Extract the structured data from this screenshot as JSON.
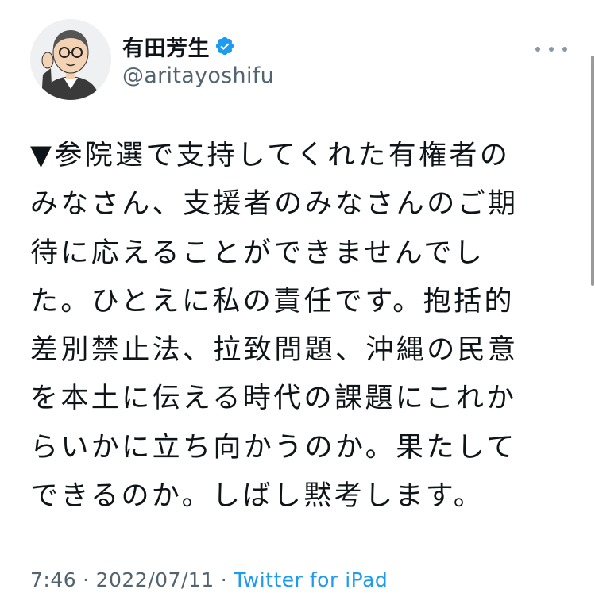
{
  "author": {
    "display_name": "有田芳生",
    "handle": "@aritayoshifu",
    "verified_icon": "verified-badge-icon",
    "avatar_icon": "caricature-avatar"
  },
  "tweet": {
    "lines": [
      "▼参院選で支持してくれた有権者の",
      "みなさん、支援者のみなさんのご期",
      "待に応えることができませんでし",
      "た。ひとえに私の責任です。抱括的",
      "差別禁止法、拉致問題、沖縄の民意",
      "を本土に伝える時代の課題にこれか",
      "らいかに立ち向かうのか。果たして",
      "できるのか。しばし黙考します。"
    ]
  },
  "meta": {
    "time": "7:46",
    "separator1": "·",
    "date": "2022/07/11",
    "separator2": "·",
    "source": "Twitter for iPad"
  },
  "colors": {
    "text": "#0f1419",
    "secondary": "#536471",
    "link": "#1d9bf0",
    "verified": "#1d9bf0"
  }
}
